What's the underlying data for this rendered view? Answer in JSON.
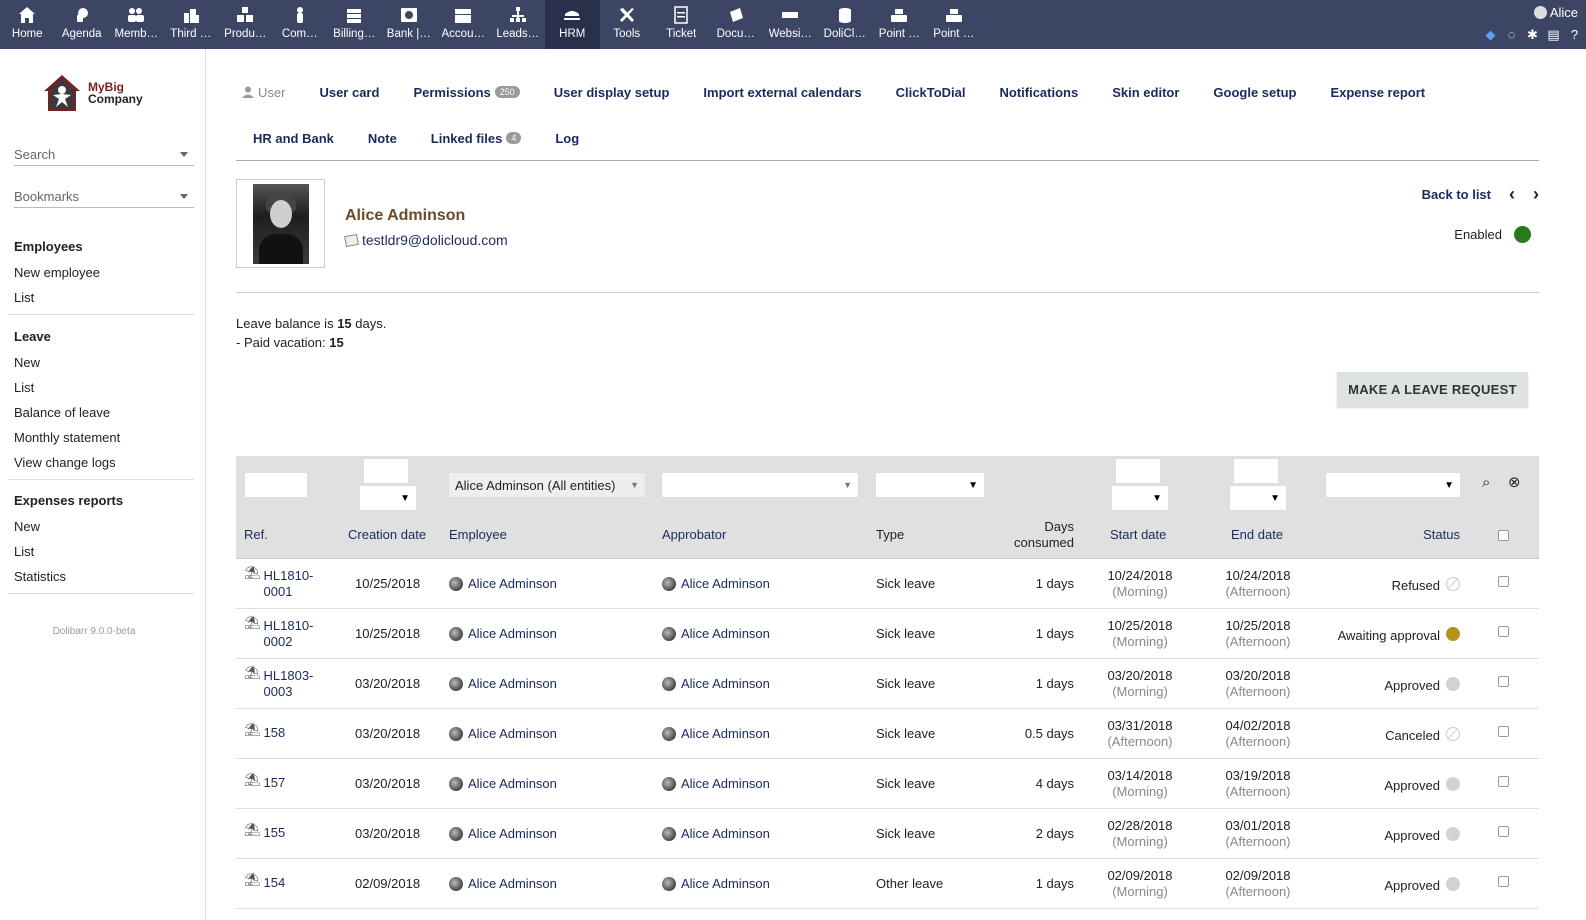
{
  "topmenu": [
    {
      "label": "Home",
      "icon": "home-icon"
    },
    {
      "label": "Agenda",
      "icon": "agenda-icon"
    },
    {
      "label": "Memb…",
      "icon": "members-icon"
    },
    {
      "label": "Third …",
      "icon": "thirdparty-icon"
    },
    {
      "label": "Produ…",
      "icon": "products-icon"
    },
    {
      "label": "Com…",
      "icon": "commercial-icon"
    },
    {
      "label": "Billing…",
      "icon": "billing-icon"
    },
    {
      "label": "Bank |…",
      "icon": "bank-icon"
    },
    {
      "label": "Accou…",
      "icon": "accounting-icon"
    },
    {
      "label": "Leads…",
      "icon": "leads-icon"
    },
    {
      "label": "HRM",
      "icon": "hrm-icon"
    },
    {
      "label": "Tools",
      "icon": "tools-icon"
    },
    {
      "label": "Ticket",
      "icon": "ticket-icon"
    },
    {
      "label": "Docu…",
      "icon": "documents-icon"
    },
    {
      "label": "Websi…",
      "icon": "websites-icon"
    },
    {
      "label": "DoliCl…",
      "icon": "dolicloud-icon"
    },
    {
      "label": "Point …",
      "icon": "pos-icon"
    },
    {
      "label": "Point …",
      "icon": "pos-icon"
    }
  ],
  "active_menu": "HRM",
  "user_login": "Alice",
  "sidebar": {
    "search_label": "Search",
    "bookmarks_label": "Bookmarks",
    "logo_line1": "MyBig",
    "logo_line2": "Company",
    "sections": [
      {
        "title": "Employees",
        "links": [
          "New employee",
          "List"
        ]
      },
      {
        "title": "Leave",
        "links": [
          "New",
          "List",
          "Balance of leave",
          "Monthly statement",
          "View change logs"
        ]
      },
      {
        "title": "Expenses reports",
        "links": [
          "New",
          "List",
          "Statistics"
        ]
      }
    ],
    "version": "Dolibarr 9.0.0-beta"
  },
  "tabs_row1": [
    {
      "label": "User",
      "badge": ""
    },
    {
      "label": "User card",
      "badge": ""
    },
    {
      "label": "Permissions",
      "badge": "250"
    },
    {
      "label": "User display setup",
      "badge": ""
    },
    {
      "label": "Import external calendars",
      "badge": ""
    },
    {
      "label": "ClickToDial",
      "badge": ""
    },
    {
      "label": "Notifications",
      "badge": ""
    },
    {
      "label": "Skin editor",
      "badge": ""
    },
    {
      "label": "Google setup",
      "badge": ""
    },
    {
      "label": "Expense report",
      "badge": ""
    }
  ],
  "tabs_row2": [
    {
      "label": "HR and Bank",
      "badge": ""
    },
    {
      "label": "Note",
      "badge": ""
    },
    {
      "label": "Linked files",
      "badge": "4"
    },
    {
      "label": "Log",
      "badge": ""
    }
  ],
  "person": {
    "name": "Alice Adminson",
    "email": "testldr9@dolicloud.com",
    "status": "Enabled",
    "status_color": "#2a7a1d"
  },
  "nav": {
    "back": "Back to list",
    "prev": "‹",
    "next": "›"
  },
  "balance": {
    "prefix": "Leave balance is ",
    "value": "15",
    "suffix": " days.",
    "line2_prefix": "- Paid vacation: ",
    "line2_value": "15"
  },
  "make_request_label": "MAKE A LEAVE REQUEST",
  "filters": {
    "employee": "Alice Adminson (All entities)"
  },
  "columns": [
    "Ref.",
    "Creation date",
    "Employee",
    "Approbator",
    "Type",
    "Days consumed",
    "Start date",
    "End date",
    "Status"
  ],
  "columns_days_line1": "Days",
  "columns_days_line2": "consumed",
  "rows": [
    {
      "ref1": "HL1810-",
      "ref2": "0001",
      "created": "10/25/2018",
      "employee": "Alice Adminson",
      "approbator": "Alice Adminson",
      "type": "Sick leave",
      "days": "1 days",
      "start": "10/24/2018",
      "start_half": "(Morning)",
      "end": "10/24/2018",
      "end_half": "(Afternoon)",
      "status": "Refused",
      "status_kind": "refused"
    },
    {
      "ref1": "HL1810-",
      "ref2": "0002",
      "created": "10/25/2018",
      "employee": "Alice Adminson",
      "approbator": "Alice Adminson",
      "type": "Sick leave",
      "days": "1 days",
      "start": "10/25/2018",
      "start_half": "(Morning)",
      "end": "10/25/2018",
      "end_half": "(Afternoon)",
      "status": "Awaiting approval",
      "status_kind": "awaiting"
    },
    {
      "ref1": "HL1803-",
      "ref2": "0003",
      "created": "03/20/2018",
      "employee": "Alice Adminson",
      "approbator": "Alice Adminson",
      "type": "Sick leave",
      "days": "1 days",
      "start": "03/20/2018",
      "start_half": "(Morning)",
      "end": "03/20/2018",
      "end_half": "(Afternoon)",
      "status": "Approved",
      "status_kind": "approved"
    },
    {
      "ref1": "158",
      "ref2": "",
      "created": "03/20/2018",
      "employee": "Alice Adminson",
      "approbator": "Alice Adminson",
      "type": "Sick leave",
      "days": "0.5 days",
      "start": "03/31/2018",
      "start_half": "(Afternoon)",
      "end": "04/02/2018",
      "end_half": "(Afternoon)",
      "status": "Canceled",
      "status_kind": "refused"
    },
    {
      "ref1": "157",
      "ref2": "",
      "created": "03/20/2018",
      "employee": "Alice Adminson",
      "approbator": "Alice Adminson",
      "type": "Sick leave",
      "days": "4 days",
      "start": "03/14/2018",
      "start_half": "(Morning)",
      "end": "03/19/2018",
      "end_half": "(Afternoon)",
      "status": "Approved",
      "status_kind": "approved"
    },
    {
      "ref1": "155",
      "ref2": "",
      "created": "03/20/2018",
      "employee": "Alice Adminson",
      "approbator": "Alice Adminson",
      "type": "Sick leave",
      "days": "2 days",
      "start": "02/28/2018",
      "start_half": "(Morning)",
      "end": "03/01/2018",
      "end_half": "(Afternoon)",
      "status": "Approved",
      "status_kind": "approved"
    },
    {
      "ref1": "154",
      "ref2": "",
      "created": "02/09/2018",
      "employee": "Alice Adminson",
      "approbator": "Alice Adminson",
      "type": "Other leave",
      "days": "1 days",
      "start": "02/09/2018",
      "start_half": "(Morning)",
      "end": "02/09/2018",
      "end_half": "(Afternoon)",
      "status": "Approved",
      "status_kind": "approved"
    }
  ],
  "colors": {
    "topbar": "#3c4664",
    "link": "#1b2a5e",
    "awaiting": "#b8901b",
    "approved": "#d3d3d3"
  }
}
